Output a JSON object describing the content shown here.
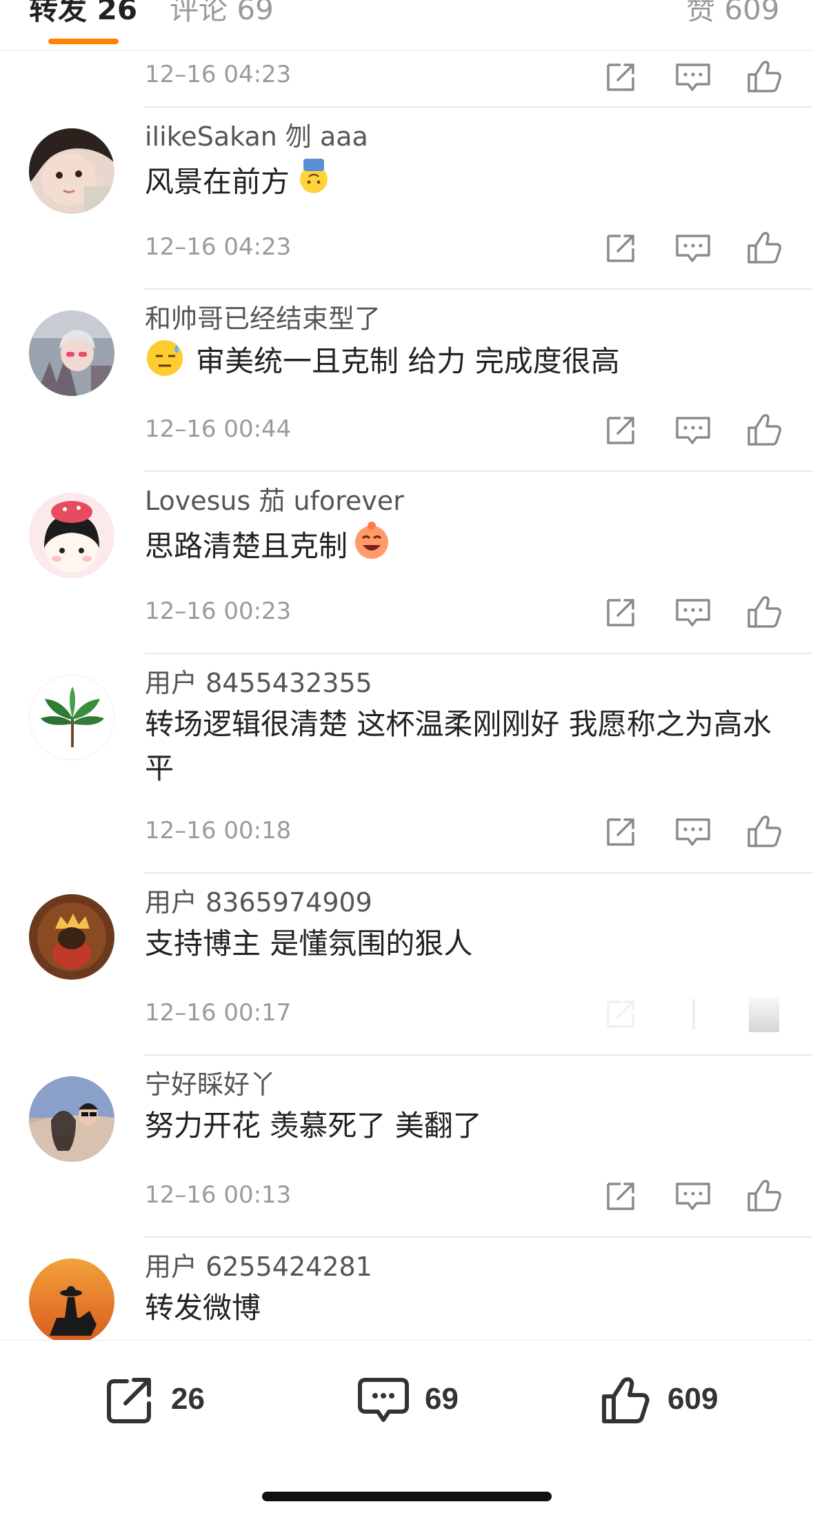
{
  "tabs": {
    "repost": "转发 26",
    "comment": "评论 69",
    "like": "赞 609"
  },
  "top_partial": {
    "time": "12–16 04:23"
  },
  "comments": [
    {
      "name": "ilikeSakan 刎 aaa",
      "text": "风景在前方",
      "time": "12–16 04:23"
    },
    {
      "name": "和帅哥已经结束型了",
      "text": "审美统一且克制 给力 完成度很高",
      "time": "12–16 00:44"
    },
    {
      "name": "Lovesus 茄 uforever",
      "text": "思路清楚且克制",
      "time": "12–16 00:23"
    },
    {
      "name": "用户 8455432355",
      "text": "转场逻辑很清楚 这杯温柔刚刚好 我愿称之为高水平",
      "time": "12–16 00:18"
    },
    {
      "name": "用户 8365974909",
      "text": "支持博主 是懂氛围的狠人",
      "time": "12–16 00:17"
    },
    {
      "name": "宁好睬好丫",
      "text": "努力开花 羡慕死了 美翻了",
      "time": "12–16 00:13"
    },
    {
      "name": "用户 6255424281",
      "text": "转发微博",
      "time": ""
    }
  ],
  "bottom_bar": {
    "repost_count": "26",
    "comment_count": "69",
    "like_count": "609"
  },
  "colors": {
    "accent": "#ff8200",
    "text": "#222222",
    "meta": "#9a9a9a",
    "icon": "#8a8a8a"
  },
  "icons": [
    "share-icon",
    "comment-icon",
    "thumbs-up-icon"
  ]
}
